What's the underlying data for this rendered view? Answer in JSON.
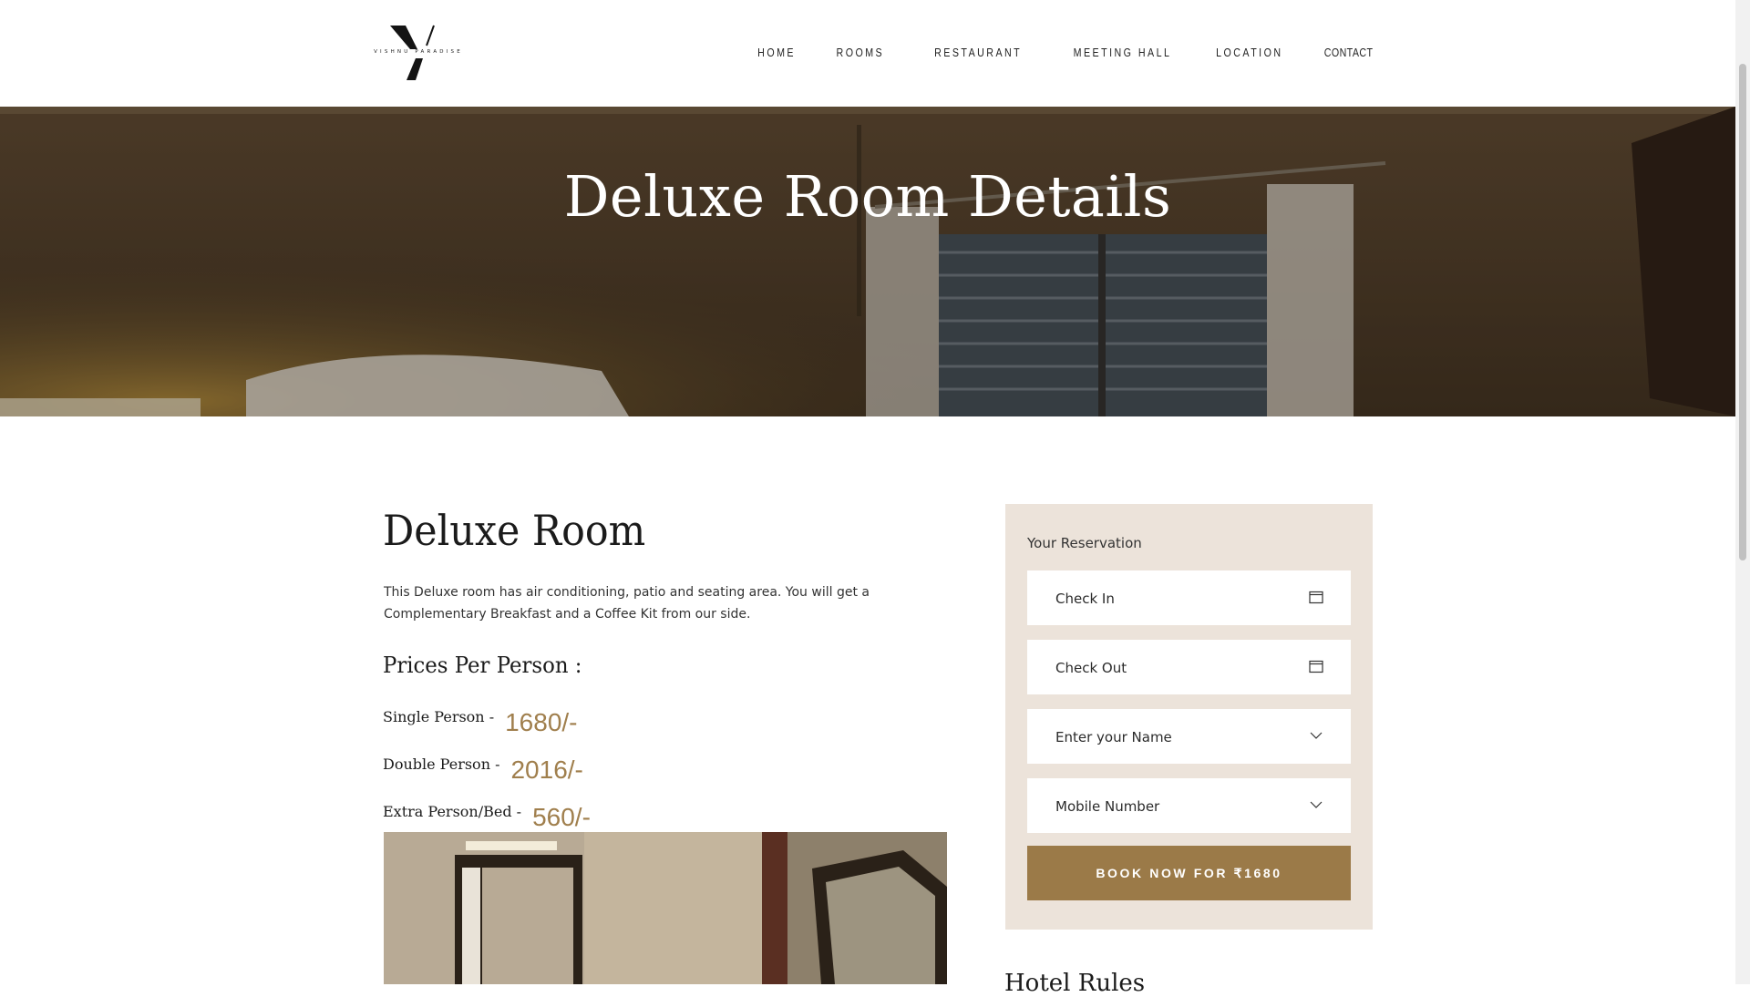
{
  "brand": {
    "logo_letter": "V",
    "logo_text": "VISHNU PARADISE"
  },
  "nav": {
    "items": [
      "HOME",
      "ROOMS",
      "RESTAURANT",
      "MEETING HALL",
      "LOCATION",
      "CONTACT"
    ]
  },
  "hero": {
    "title": "Deluxe Room Details"
  },
  "room": {
    "title": "Deluxe Room",
    "description": "This Deluxe room has air conditioning, patio and seating area. You will get a Complementary Breakfast and a Coffee Kit from our side.",
    "prices_heading": "Prices Per Person :",
    "prices": [
      {
        "label": "Single Person -",
        "value": "1680/-"
      },
      {
        "label": "Double Person -",
        "value": "2016/-"
      },
      {
        "label": "Extra Person/Bed -",
        "value": "560/-"
      }
    ]
  },
  "reservation": {
    "title": "Your Reservation",
    "fields": [
      {
        "label": "Check In",
        "icon": "calendar-icon"
      },
      {
        "label": "Check Out",
        "icon": "calendar-icon"
      },
      {
        "label": "Enter your Name",
        "icon": "chevron-down-icon"
      },
      {
        "label": "Mobile Number",
        "icon": "chevron-down-icon"
      }
    ],
    "book_label": "BOOK NOW FOR ₹1680"
  },
  "sidebar_next": {
    "heading": "Hotel Rules"
  },
  "colors": {
    "accent": "#9b7a48",
    "price": "#a07f4d",
    "card_bg": "#ece3da"
  }
}
